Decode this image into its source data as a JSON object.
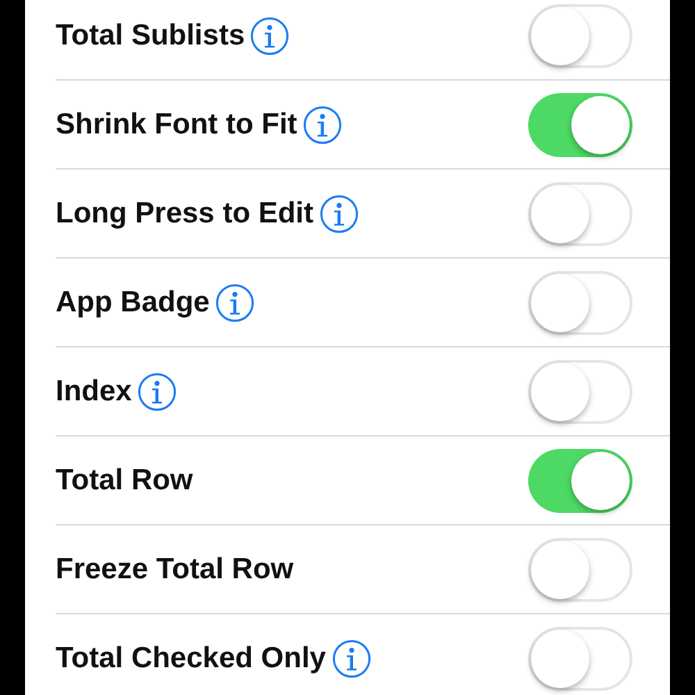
{
  "settings": [
    {
      "label": "Total Sublists",
      "info": true,
      "on": false
    },
    {
      "label": "Shrink Font to Fit",
      "info": true,
      "on": true
    },
    {
      "label": "Long Press to Edit",
      "info": true,
      "on": false
    },
    {
      "label": "App Badge",
      "info": true,
      "on": false
    },
    {
      "label": "Index",
      "info": true,
      "on": false
    },
    {
      "label": "Total Row",
      "info": false,
      "on": true
    },
    {
      "label": "Freeze Total Row",
      "info": false,
      "on": false
    },
    {
      "label": "Total Checked Only",
      "info": true,
      "on": false
    }
  ]
}
